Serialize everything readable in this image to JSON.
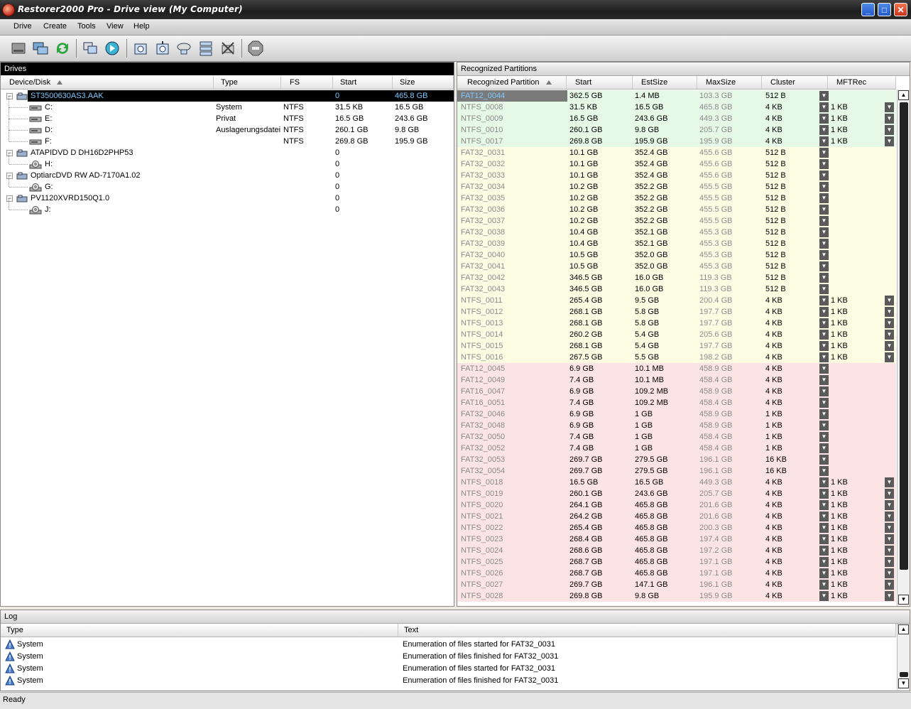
{
  "window": {
    "title": "Restorer2000 Pro - Drive view (My Computer)"
  },
  "menu": [
    "Drive",
    "Create",
    "Tools",
    "View",
    "Help"
  ],
  "toolbar": [
    "drive-icon",
    "network-drive-icon",
    "refresh-icon",
    "copy-disk-icon",
    "scan-icon",
    "open-image-icon",
    "create-image-icon",
    "region-icon",
    "raid-icon",
    "remove-icon",
    "stop-icon"
  ],
  "drives": {
    "header": "Drives",
    "columns": [
      "Device/Disk",
      "Type",
      "FS",
      "Start",
      "Size"
    ],
    "rows": [
      {
        "name": "ST3500630AS3.AAK",
        "type": "",
        "fs": "",
        "start": "0",
        "size": "465.8 GB",
        "level": 0,
        "kind": "disk",
        "selected": true
      },
      {
        "name": "C:",
        "type": "System",
        "fs": "NTFS",
        "start": "31.5 KB",
        "size": "16.5 GB",
        "level": 1,
        "kind": "part",
        "selected": false
      },
      {
        "name": "E:",
        "type": "Privat",
        "fs": "NTFS",
        "start": "16.5 GB",
        "size": "243.6 GB",
        "level": 1,
        "kind": "part",
        "selected": false
      },
      {
        "name": "D:",
        "type": "Auslagerungsdatei",
        "fs": "NTFS",
        "start": "260.1 GB",
        "size": "9.8 GB",
        "level": 1,
        "kind": "part",
        "selected": false
      },
      {
        "name": "F:",
        "type": "",
        "fs": "NTFS",
        "start": "269.8 GB",
        "size": "195.9 GB",
        "level": 1,
        "kind": "part",
        "selected": false
      },
      {
        "name": "ATAPIDVD D DH16D2PHP53",
        "type": "",
        "fs": "",
        "start": "0",
        "size": "",
        "level": 0,
        "kind": "disk",
        "selected": false
      },
      {
        "name": "H:",
        "type": "",
        "fs": "",
        "start": "0",
        "size": "",
        "level": 1,
        "kind": "cd",
        "selected": false
      },
      {
        "name": "OptiarcDVD RW AD-7170A1.02",
        "type": "",
        "fs": "",
        "start": "0",
        "size": "",
        "level": 0,
        "kind": "disk",
        "selected": false
      },
      {
        "name": "G:",
        "type": "",
        "fs": "",
        "start": "0",
        "size": "",
        "level": 1,
        "kind": "cd",
        "selected": false
      },
      {
        "name": "PV1120XVRD150Q1.0",
        "type": "",
        "fs": "",
        "start": "0",
        "size": "",
        "level": 0,
        "kind": "disk",
        "selected": false
      },
      {
        "name": "J:",
        "type": "",
        "fs": "",
        "start": "0",
        "size": "",
        "level": 1,
        "kind": "cd",
        "selected": false
      }
    ]
  },
  "partitions": {
    "header": "Recognized Partitions",
    "columns": [
      "Recognized Partition",
      "Start",
      "EstSize",
      "MaxSize",
      "Cluster",
      "MFTRec"
    ],
    "colors": {
      "green": "#e6f8e6",
      "yellow": "#fdfde4",
      "red": "#fde4e4"
    },
    "rows": [
      {
        "name": "FAT12_0044",
        "start": "362.5 GB",
        "est": "1.4 MB",
        "max": "103.3 GB",
        "cluster": "512 B",
        "mft": "",
        "color": "green",
        "selected": true
      },
      {
        "name": "NTFS_0008",
        "start": "31.5 KB",
        "est": "16.5 GB",
        "max": "465.8 GB",
        "cluster": "4 KB",
        "mft": "1 KB",
        "color": "green"
      },
      {
        "name": "NTFS_0009",
        "start": "16.5 GB",
        "est": "243.6 GB",
        "max": "449.3 GB",
        "cluster": "4 KB",
        "mft": "1 KB",
        "color": "green"
      },
      {
        "name": "NTFS_0010",
        "start": "260.1 GB",
        "est": "9.8 GB",
        "max": "205.7 GB",
        "cluster": "4 KB",
        "mft": "1 KB",
        "color": "green"
      },
      {
        "name": "NTFS_0017",
        "start": "269.8 GB",
        "est": "195.9 GB",
        "max": "195.9 GB",
        "cluster": "4 KB",
        "mft": "1 KB",
        "color": "green"
      },
      {
        "name": "FAT32_0031",
        "start": "10.1 GB",
        "est": "352.4 GB",
        "max": "455.6 GB",
        "cluster": "512 B",
        "mft": "",
        "color": "yellow"
      },
      {
        "name": "FAT32_0032",
        "start": "10.1 GB",
        "est": "352.4 GB",
        "max": "455.6 GB",
        "cluster": "512 B",
        "mft": "",
        "color": "yellow"
      },
      {
        "name": "FAT32_0033",
        "start": "10.1 GB",
        "est": "352.4 GB",
        "max": "455.6 GB",
        "cluster": "512 B",
        "mft": "",
        "color": "yellow"
      },
      {
        "name": "FAT32_0034",
        "start": "10.2 GB",
        "est": "352.2 GB",
        "max": "455.5 GB",
        "cluster": "512 B",
        "mft": "",
        "color": "yellow"
      },
      {
        "name": "FAT32_0035",
        "start": "10.2 GB",
        "est": "352.2 GB",
        "max": "455.5 GB",
        "cluster": "512 B",
        "mft": "",
        "color": "yellow"
      },
      {
        "name": "FAT32_0036",
        "start": "10.2 GB",
        "est": "352.2 GB",
        "max": "455.5 GB",
        "cluster": "512 B",
        "mft": "",
        "color": "yellow"
      },
      {
        "name": "FAT32_0037",
        "start": "10.2 GB",
        "est": "352.2 GB",
        "max": "455.5 GB",
        "cluster": "512 B",
        "mft": "",
        "color": "yellow"
      },
      {
        "name": "FAT32_0038",
        "start": "10.4 GB",
        "est": "352.1 GB",
        "max": "455.3 GB",
        "cluster": "512 B",
        "mft": "",
        "color": "yellow"
      },
      {
        "name": "FAT32_0039",
        "start": "10.4 GB",
        "est": "352.1 GB",
        "max": "455.3 GB",
        "cluster": "512 B",
        "mft": "",
        "color": "yellow"
      },
      {
        "name": "FAT32_0040",
        "start": "10.5 GB",
        "est": "352.0 GB",
        "max": "455.3 GB",
        "cluster": "512 B",
        "mft": "",
        "color": "yellow"
      },
      {
        "name": "FAT32_0041",
        "start": "10.5 GB",
        "est": "352.0 GB",
        "max": "455.3 GB",
        "cluster": "512 B",
        "mft": "",
        "color": "yellow"
      },
      {
        "name": "FAT32_0042",
        "start": "346.5 GB",
        "est": "16.0 GB",
        "max": "119.3 GB",
        "cluster": "512 B",
        "mft": "",
        "color": "yellow"
      },
      {
        "name": "FAT32_0043",
        "start": "346.5 GB",
        "est": "16.0 GB",
        "max": "119.3 GB",
        "cluster": "512 B",
        "mft": "",
        "color": "yellow"
      },
      {
        "name": "NTFS_0011",
        "start": "265.4 GB",
        "est": "9.5 GB",
        "max": "200.4 GB",
        "cluster": "4 KB",
        "mft": "1 KB",
        "color": "yellow"
      },
      {
        "name": "NTFS_0012",
        "start": "268.1 GB",
        "est": "5.8 GB",
        "max": "197.7 GB",
        "cluster": "4 KB",
        "mft": "1 KB",
        "color": "yellow"
      },
      {
        "name": "NTFS_0013",
        "start": "268.1 GB",
        "est": "5.8 GB",
        "max": "197.7 GB",
        "cluster": "4 KB",
        "mft": "1 KB",
        "color": "yellow"
      },
      {
        "name": "NTFS_0014",
        "start": "260.2 GB",
        "est": "5.4 GB",
        "max": "205.6 GB",
        "cluster": "4 KB",
        "mft": "1 KB",
        "color": "yellow"
      },
      {
        "name": "NTFS_0015",
        "start": "268.1 GB",
        "est": "5.4 GB",
        "max": "197.7 GB",
        "cluster": "4 KB",
        "mft": "1 KB",
        "color": "yellow"
      },
      {
        "name": "NTFS_0016",
        "start": "267.5 GB",
        "est": "5.5 GB",
        "max": "198.2 GB",
        "cluster": "4 KB",
        "mft": "1 KB",
        "color": "yellow"
      },
      {
        "name": "FAT12_0045",
        "start": "6.9 GB",
        "est": "10.1 MB",
        "max": "458.9 GB",
        "cluster": "4 KB",
        "mft": "",
        "color": "red"
      },
      {
        "name": "FAT12_0049",
        "start": "7.4 GB",
        "est": "10.1 MB",
        "max": "458.4 GB",
        "cluster": "4 KB",
        "mft": "",
        "color": "red"
      },
      {
        "name": "FAT16_0047",
        "start": "6.9 GB",
        "est": "109.2 MB",
        "max": "458.9 GB",
        "cluster": "4 KB",
        "mft": "",
        "color": "red"
      },
      {
        "name": "FAT16_0051",
        "start": "7.4 GB",
        "est": "109.2 MB",
        "max": "458.4 GB",
        "cluster": "4 KB",
        "mft": "",
        "color": "red"
      },
      {
        "name": "FAT32_0046",
        "start": "6.9 GB",
        "est": "1 GB",
        "max": "458.9 GB",
        "cluster": "1 KB",
        "mft": "",
        "color": "red"
      },
      {
        "name": "FAT32_0048",
        "start": "6.9 GB",
        "est": "1 GB",
        "max": "458.9 GB",
        "cluster": "1 KB",
        "mft": "",
        "color": "red"
      },
      {
        "name": "FAT32_0050",
        "start": "7.4 GB",
        "est": "1 GB",
        "max": "458.4 GB",
        "cluster": "1 KB",
        "mft": "",
        "color": "red"
      },
      {
        "name": "FAT32_0052",
        "start": "7.4 GB",
        "est": "1 GB",
        "max": "458.4 GB",
        "cluster": "1 KB",
        "mft": "",
        "color": "red"
      },
      {
        "name": "FAT32_0053",
        "start": "269.7 GB",
        "est": "279.5 GB",
        "max": "196.1 GB",
        "cluster": "16 KB",
        "mft": "",
        "color": "red"
      },
      {
        "name": "FAT32_0054",
        "start": "269.7 GB",
        "est": "279.5 GB",
        "max": "196.1 GB",
        "cluster": "16 KB",
        "mft": "",
        "color": "red"
      },
      {
        "name": "NTFS_0018",
        "start": "16.5 GB",
        "est": "16.5 GB",
        "max": "449.3 GB",
        "cluster": "4 KB",
        "mft": "1 KB",
        "color": "red"
      },
      {
        "name": "NTFS_0019",
        "start": "260.1 GB",
        "est": "243.6 GB",
        "max": "205.7 GB",
        "cluster": "4 KB",
        "mft": "1 KB",
        "color": "red"
      },
      {
        "name": "NTFS_0020",
        "start": "264.1 GB",
        "est": "465.8 GB",
        "max": "201.6 GB",
        "cluster": "4 KB",
        "mft": "1 KB",
        "color": "red"
      },
      {
        "name": "NTFS_0021",
        "start": "264.2 GB",
        "est": "465.8 GB",
        "max": "201.6 GB",
        "cluster": "4 KB",
        "mft": "1 KB",
        "color": "red"
      },
      {
        "name": "NTFS_0022",
        "start": "265.4 GB",
        "est": "465.8 GB",
        "max": "200.3 GB",
        "cluster": "4 KB",
        "mft": "1 KB",
        "color": "red"
      },
      {
        "name": "NTFS_0023",
        "start": "268.4 GB",
        "est": "465.8 GB",
        "max": "197.4 GB",
        "cluster": "4 KB",
        "mft": "1 KB",
        "color": "red"
      },
      {
        "name": "NTFS_0024",
        "start": "268.6 GB",
        "est": "465.8 GB",
        "max": "197.2 GB",
        "cluster": "4 KB",
        "mft": "1 KB",
        "color": "red"
      },
      {
        "name": "NTFS_0025",
        "start": "268.7 GB",
        "est": "465.8 GB",
        "max": "197.1 GB",
        "cluster": "4 KB",
        "mft": "1 KB",
        "color": "red"
      },
      {
        "name": "NTFS_0026",
        "start": "268.7 GB",
        "est": "465.8 GB",
        "max": "197.1 GB",
        "cluster": "4 KB",
        "mft": "1 KB",
        "color": "red"
      },
      {
        "name": "NTFS_0027",
        "start": "269.7 GB",
        "est": "147.1 GB",
        "max": "196.1 GB",
        "cluster": "4 KB",
        "mft": "1 KB",
        "color": "red"
      },
      {
        "name": "NTFS_0028",
        "start": "269.8 GB",
        "est": "9.8 GB",
        "max": "195.9 GB",
        "cluster": "4 KB",
        "mft": "1 KB",
        "color": "red"
      }
    ]
  },
  "log": {
    "header": "Log",
    "columns": [
      "Type",
      "Text"
    ],
    "rows": [
      {
        "type": "System",
        "text": "Enumeration of files started for FAT32_0031"
      },
      {
        "type": "System",
        "text": "Enumeration of files finished for FAT32_0031"
      },
      {
        "type": "System",
        "text": "Enumeration of files started for FAT32_0031"
      },
      {
        "type": "System",
        "text": "Enumeration of files finished for FAT32_0031"
      }
    ]
  },
  "status": "Ready"
}
